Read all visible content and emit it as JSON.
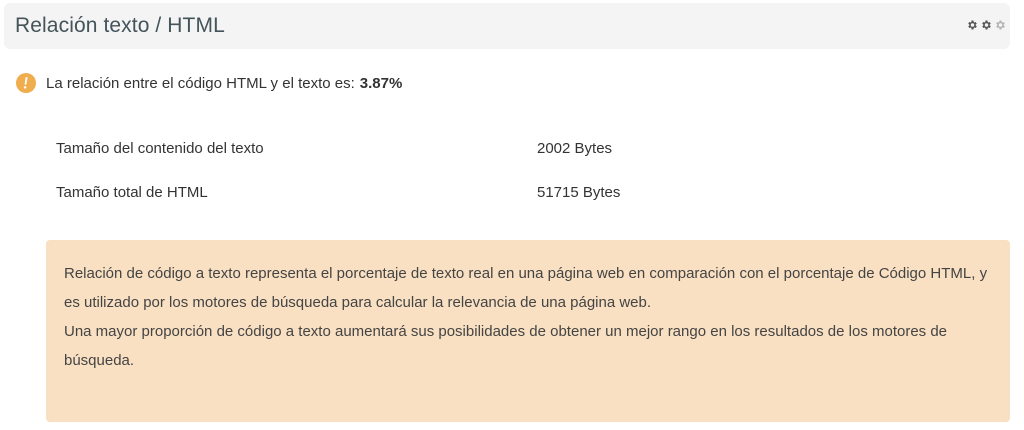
{
  "header": {
    "title": "Relación texto / HTML",
    "menu_icons": [
      "gear-icon",
      "gear-icon",
      "gear-icon"
    ]
  },
  "result": {
    "icon": "warning-icon",
    "icon_color": "#f0ad4e",
    "text": "La relación entre el código HTML y el texto es:",
    "value": "3.87%"
  },
  "stats": [
    {
      "label": "Tamaño del contenido del texto",
      "value": "2002 Bytes"
    },
    {
      "label": "Tamaño total de HTML",
      "value": "51715 Bytes"
    }
  ],
  "info": {
    "background": "#f9e0c2",
    "paragraph1": "Relación de código a texto representa el porcentaje de texto real en una página web en comparación con el porcentaje de Código HTML, y es utilizado por los motores de búsqueda para calcular la relevancia de una página web.",
    "paragraph2": "Una mayor proporción de código a texto aumentará sus posibilidades de obtener un mejor rango en los resultados de los motores de búsqueda."
  }
}
